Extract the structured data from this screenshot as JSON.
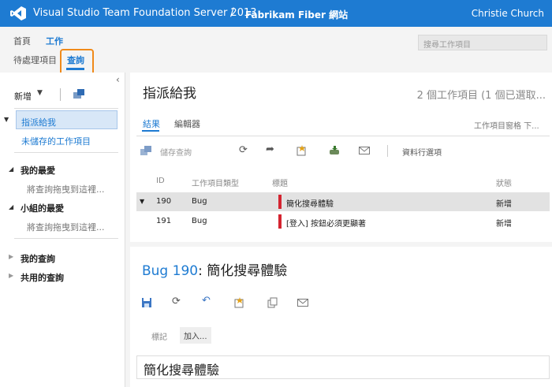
{
  "header": {
    "product": "Visual Studio Team Foundation Server 2013",
    "separator": "/",
    "project": "Fabrikam Fiber 網站",
    "user": "Christie Church"
  },
  "nav": {
    "primary": [
      "首頁",
      "工作"
    ],
    "secondary": [
      "待處理項目",
      "查詢"
    ],
    "search_placeholder": "搜尋工作項目"
  },
  "left": {
    "new_label": "新增",
    "items": {
      "assigned_to_me": "指派給我",
      "unsaved": "未儲存的工作項目",
      "my_favorites": "我的最愛",
      "drag_hint_1": "將查詢拖曳到這裡...",
      "team_favorites": "小組的最愛",
      "drag_hint_2": "將查詢拖曳到這裡...",
      "my_queries": "我的查詢",
      "shared_queries": "共用的查詢"
    }
  },
  "results": {
    "title": "指派給我",
    "count": "2 個工作項目 (1 個已選取...",
    "tabs": [
      "結果",
      "編輯器"
    ],
    "grid_option": "工作項目窗格  下...",
    "save_query": "儲存查詢",
    "column_options": "資料行選項",
    "columns": [
      "ID",
      "工作項目類型",
      "標題",
      "狀態"
    ],
    "rows": [
      {
        "id": "190",
        "type": "Bug",
        "title": "簡化搜尋體驗",
        "state": "新增"
      },
      {
        "id": "191",
        "type": "Bug",
        "title": "[登入] 按鈕必須更顯著",
        "state": "新增"
      }
    ]
  },
  "detail": {
    "bug_label": "Bug 190",
    "colon": ":",
    "title": "簡化搜尋體驗",
    "tags_label": "標記",
    "add_tag": "加入...",
    "title_field": "簡化搜尋體驗"
  },
  "colors": {
    "brand": "#1e7bd2",
    "highlight": "#f08a1a",
    "bug_marker": "#d42430"
  }
}
